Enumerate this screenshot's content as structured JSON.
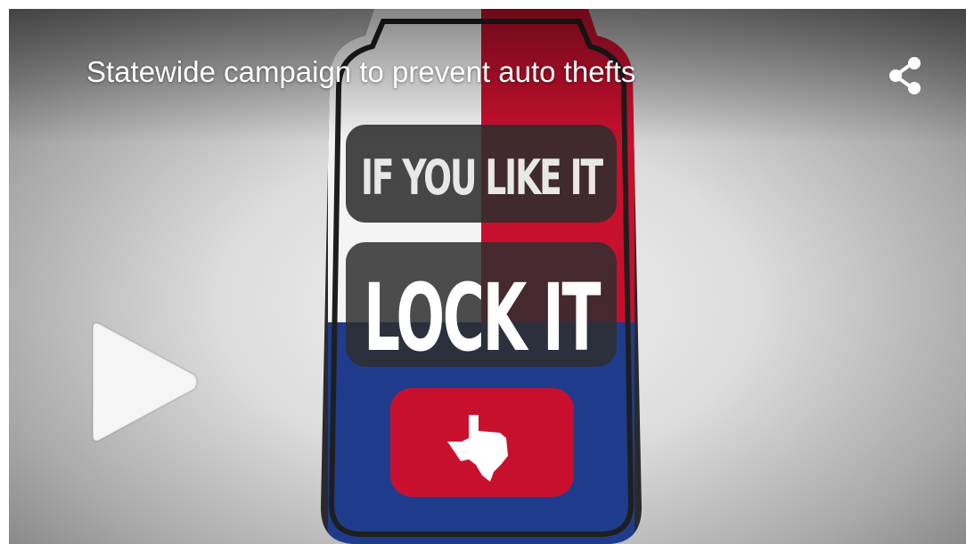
{
  "video": {
    "title": "Statewide campaign to prevent auto thefts"
  },
  "artwork": {
    "line1": "IF YOU LIKE IT",
    "line2": "LOCK IT"
  },
  "colors": {
    "red": "#c8102e",
    "blue": "#1f3c8c",
    "white": "#ffffff",
    "dark_panel": "#2e2e2e"
  },
  "icons": {
    "share": "share-icon",
    "play": "play-icon",
    "state": "texas-outline-icon"
  }
}
